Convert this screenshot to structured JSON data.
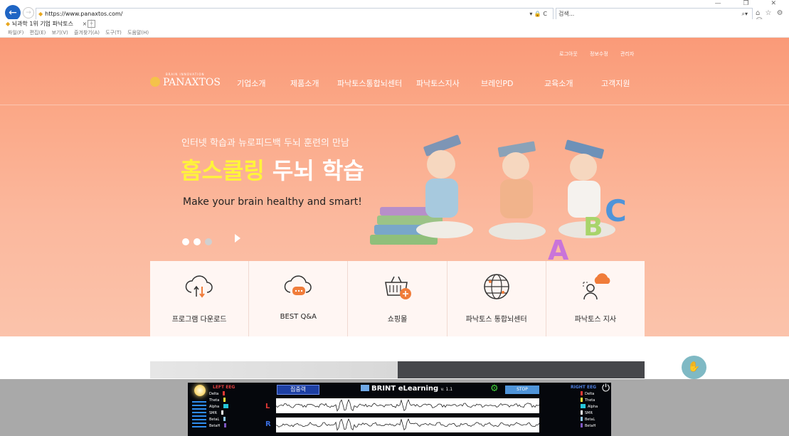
{
  "browser": {
    "url": "https://www.panaxtos.com/",
    "search_placeholder": "검색...",
    "addr_tools": "▾ 🔒 C",
    "search_icon": "⌕▾",
    "toolbar_icons": "⌂ ☆ ⚙ ☺",
    "window_controls": "— ❐ ✕",
    "tab_title": "뇌과학 1위 기업 파낙토스",
    "tab_close": "×",
    "menu": [
      "파일(F)",
      "편집(E)",
      "보기(V)",
      "즐겨찾기(A)",
      "도구(T)",
      "도움말(H)"
    ]
  },
  "site": {
    "util_links": [
      "로그아웃",
      "정보수정",
      "관리자"
    ],
    "logo_text": "PANAXTOS",
    "logo_tagline": "BRAIN INNOVATION",
    "nav": [
      "기업소개",
      "제품소개",
      "파낙토스통합뇌센터",
      "파낙토스지사",
      "브레인PD",
      "교육소개",
      "고객지원"
    ],
    "hero": {
      "subtitle": "인터넷 학습과 뉴로피드백 두뇌 훈련의 만남",
      "title_highlight": "홈스쿨링",
      "title_rest": " 두뇌 학습",
      "tagline_en": "Make your brain healthy and smart!"
    },
    "quick_menu": [
      {
        "label": "프로그램 다운로드",
        "icon": "cloud-download-icon"
      },
      {
        "label": "BEST Q&A",
        "icon": "chat-cloud-icon"
      },
      {
        "label": "쇼핑몰",
        "icon": "shopping-basket-icon"
      },
      {
        "label": "파낙토스 통합뇌센터",
        "icon": "globe-icon"
      },
      {
        "label": "파낙토스 지사",
        "icon": "user-cloud-icon"
      }
    ]
  },
  "eeg_app": {
    "title": "BRINT eLearning",
    "version": "v. 1.1",
    "focus_label": "집중력",
    "stop_label": "STOP",
    "left_header": "LEFT EEG",
    "right_header": "RIGHT EEG",
    "bands": [
      "Delta",
      "Theta",
      "Alpha",
      "SMR",
      "BetaL",
      "BetaH"
    ],
    "band_colors": [
      "#e53935",
      "#ffeb3b",
      "#26c6da",
      "#fafafa",
      "#90caf9",
      "#7e57c2"
    ],
    "channel_left": "L",
    "channel_right": "R"
  },
  "colors": {
    "hero_bg": "#fba887",
    "highlight": "#fff43a",
    "browser_back": "#1f65c4"
  }
}
